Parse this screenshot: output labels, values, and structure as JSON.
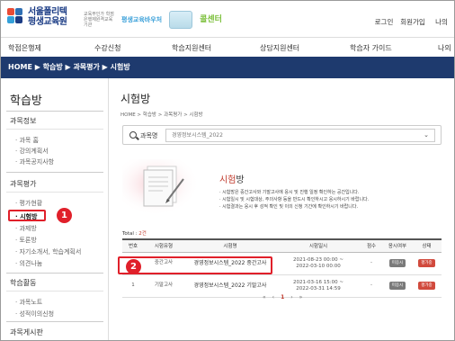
{
  "header": {
    "logo_line1": "서울폴리텍",
    "logo_line2": "평생교육원",
    "partners": [
      "교육부인가 학점은행제원격교육기관",
      "평생교육바우처",
      "",
      "콜센터"
    ],
    "toplinks": [
      "로그인",
      "회원가입",
      "나의"
    ]
  },
  "gnb": [
    "학점은행제",
    "수강신청",
    "학습지원센터",
    "상담지원센터",
    "학습자 가이드",
    "나의"
  ],
  "crumbbar": "HOME ▶ 학습방 ▶ 과목평가 ▶ 시험방",
  "sidebar": {
    "title": "학습방",
    "sections": [
      {
        "head": "과목정보",
        "items": [
          "과목 홈",
          "강의계획서",
          "과목공지사항"
        ]
      },
      {
        "head": "과목평가",
        "items": [
          "평가현황",
          "시험방",
          "과제방",
          "토론방",
          "자기소개서, 학습계획서",
          "의견나눔"
        ]
      },
      {
        "head": "학습활동",
        "items": [
          "과목노트",
          "성적이의신청"
        ]
      },
      {
        "head": "과목게시판",
        "items": []
      }
    ],
    "active_item": "시험방"
  },
  "main": {
    "title": "시험방",
    "breadcrumb": "HOME > 학습방 > 과목평가 > 시험방",
    "search_label": "과목명",
    "search_value": "경영정보시스템_2022",
    "intro_title_accent": "시험",
    "intro_title_rest": "방",
    "bullets": [
      "· 시험방은 중간고사와 기말고사에 응시 및 진행 일정 확인하는 공간입니다.",
      "· 시험일시 및 시험대상, 주의사항 등을 반드시 확인하시고 응시하시기 바랍니다.",
      "· 시험결과는 응시 후 성적 확인 및 이의 신청 기간에 확인하시기 바랍니다."
    ],
    "total_label": "Total : ",
    "total_count": "2건",
    "table": {
      "headers": [
        "번호",
        "시험유형",
        "시험명",
        "시험일시",
        "점수",
        "응시여부",
        "상태"
      ],
      "rows": [
        {
          "no": "2",
          "type": "중간고사",
          "name": "경영정보시스템_2022 중간고사",
          "period_start": "2021-08-23 00:00 ~",
          "period_end": "2022-03-10 00:00",
          "score": "-",
          "taken": "미응시",
          "status": "평가중"
        },
        {
          "no": "1",
          "type": "기말고사",
          "name": "경영정보시스템_2022 기말고사",
          "period_start": "2021-03-16 15:00 ~",
          "period_end": "2022-03-31 14:59",
          "score": "-",
          "taken": "미응시",
          "status": "평가중"
        }
      ]
    },
    "pager": [
      "«",
      "‹",
      "1",
      "›",
      "»"
    ],
    "current_page": "1"
  },
  "annotations": {
    "badge1": "1",
    "badge2": "2"
  },
  "colors": {
    "navy": "#1e3a6e",
    "highlight_red": "#e0202a",
    "accent_red": "#c0392b"
  }
}
